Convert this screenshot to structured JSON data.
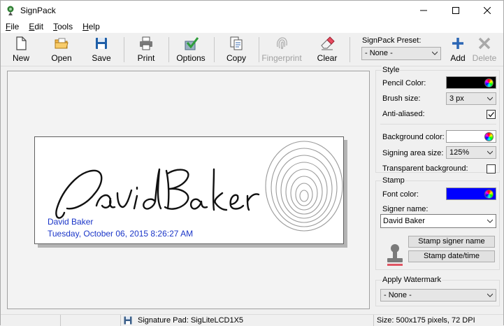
{
  "window": {
    "title": "SignPack"
  },
  "menu": [
    {
      "key": "F",
      "rest": "ile"
    },
    {
      "key": "E",
      "rest": "dit"
    },
    {
      "key": "T",
      "rest": "ools"
    },
    {
      "key": "H",
      "rest": "elp"
    }
  ],
  "toolbar": {
    "new": "New",
    "open": "Open",
    "save": "Save",
    "print": "Print",
    "options": "Options",
    "copy": "Copy",
    "fingerprint": "Fingerprint",
    "clear": "Clear",
    "preset_label": "SignPack Preset:",
    "preset_value": "- None -",
    "add": "Add",
    "delete": "Delete"
  },
  "signature": {
    "stamp_name": "David Baker",
    "stamp_date": "Tuesday, October 06, 2015 8:26:27 AM"
  },
  "style": {
    "title": "Style",
    "pencil_color_label": "Pencil Color:",
    "pencil_color": "#000000",
    "brush_size_label": "Brush size:",
    "brush_size": "3 px",
    "anti_aliased_label": "Anti-aliased:",
    "anti_aliased": true,
    "background_color_label": "Background color:",
    "background_color": "#ffffff",
    "signing_area_label": "Signing area size:",
    "signing_area": "125%",
    "transparent_bg_label": "Transparent background:",
    "transparent_bg": false
  },
  "stamp": {
    "title": "Stamp",
    "font_color_label": "Font color:",
    "font_color": "#0000ff",
    "signer_name_label": "Signer name:",
    "signer_name": "David Baker",
    "stamp_name_button": "Stamp signer name",
    "stamp_date_button": "Stamp date/time"
  },
  "watermark": {
    "title": "Apply Watermark",
    "value": "- None -"
  },
  "status": {
    "pad": "Signature Pad: SigLiteLCD1X5",
    "size": "Size: 500x175 pixels, 72 DPI"
  }
}
